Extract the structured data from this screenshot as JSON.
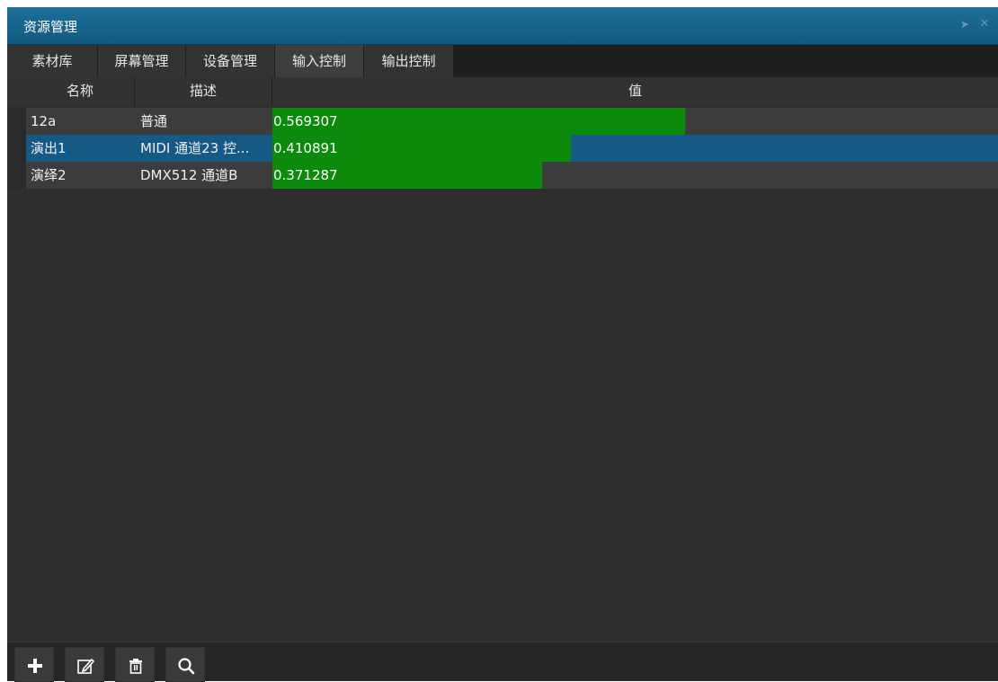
{
  "window": {
    "title": "资源管理"
  },
  "tabs": [
    {
      "label": "素材库"
    },
    {
      "label": "屏幕管理"
    },
    {
      "label": "设备管理"
    },
    {
      "label": "输入控制"
    },
    {
      "label": "输出控制"
    }
  ],
  "active_tab": "输入控制",
  "table": {
    "columns": {
      "name": "名称",
      "desc": "描述",
      "value": "值"
    },
    "rows": [
      {
        "name": "12a",
        "desc": "普通",
        "value": "0.569307",
        "fraction": 0.569307,
        "selected": false
      },
      {
        "name": "演出1",
        "desc": "MIDI 通道23 控...",
        "value": "0.410891",
        "fraction": 0.410891,
        "selected": true
      },
      {
        "name": "演绎2",
        "desc": "DMX512 通道B",
        "value": "0.371287",
        "fraction": 0.371287,
        "selected": false
      }
    ]
  },
  "colors": {
    "title_bar": "#1c6f99",
    "selection": "#155a86",
    "value_bar": "#0c8a0c",
    "background": "#2e2e2e"
  },
  "toolbar": {
    "buttons": [
      {
        "icon": "plus-icon"
      },
      {
        "icon": "edit-icon"
      },
      {
        "icon": "trash-icon"
      },
      {
        "icon": "search-icon"
      }
    ]
  }
}
